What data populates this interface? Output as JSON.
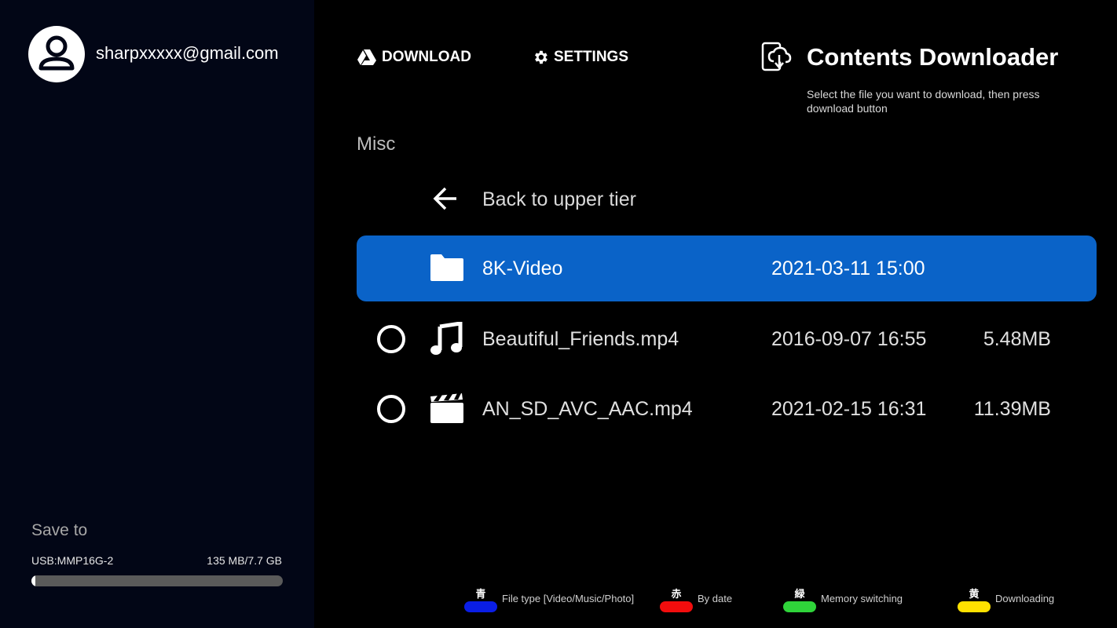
{
  "account": {
    "email": "sharpxxxxx@gmail.com",
    "avatar_icon": "account-circle-icon"
  },
  "tabs": [
    {
      "label": "DOWNLOAD",
      "icon": "google-drive-icon",
      "active": true
    },
    {
      "label": "SETTINGS",
      "icon": "gear-icon",
      "active": false
    }
  ],
  "app": {
    "title": "Contents Downloader",
    "subtitle": "Select the file you want to download, then press download button",
    "icon": "cloud-download-device-icon"
  },
  "folder": {
    "name": "Misc"
  },
  "back": {
    "label": "Back to upper tier",
    "icon": "arrow-back-icon"
  },
  "files": [
    {
      "name": "8K-Video",
      "date": "2021-03-11 15:00",
      "size": "",
      "type": "folder",
      "icon": "folder-icon",
      "selected": true
    },
    {
      "name": "Beautiful_Friends.mp4",
      "date": "2016-09-07 16:55",
      "size": "5.48MB",
      "type": "music",
      "icon": "music-note-icon",
      "selected": false
    },
    {
      "name": "AN_SD_AVC_AAC.mp4",
      "date": "2021-02-15 16:31",
      "size": "11.39MB",
      "type": "video",
      "icon": "clapperboard-icon",
      "selected": false
    }
  ],
  "save_to": {
    "title": "Save to",
    "device": "USB:MMP16G-2",
    "usage": "135 MB/7.7 GB",
    "used_fraction": 0.017
  },
  "legend": [
    {
      "key_char": "青",
      "color": "#0a1ee6",
      "label": "File type [Video/Music/Photo]"
    },
    {
      "key_char": "赤",
      "color": "#f20d0d",
      "label": "By date"
    },
    {
      "key_char": "緑",
      "color": "#2fd43a",
      "label": "Memory switching"
    },
    {
      "key_char": "黄",
      "color": "#ffe100",
      "label": "Downloading"
    }
  ],
  "colors": {
    "selection": "#0a63c8",
    "sidebar_bg": "#020616"
  }
}
